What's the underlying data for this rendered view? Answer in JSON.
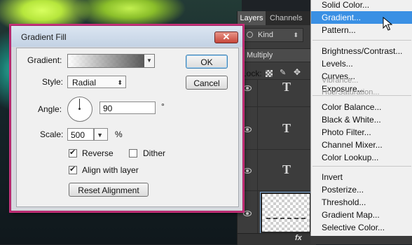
{
  "dialog": {
    "title": "Gradient Fill",
    "close_glyph": "✕",
    "gradient_label": "Gradient:",
    "style_label": "Style:",
    "style_value": "Radial",
    "angle_label": "Angle:",
    "angle_value": "90",
    "angle_unit": "°",
    "scale_label": "Scale:",
    "scale_value": "500",
    "scale_unit": "%",
    "reverse_label": "Reverse",
    "reverse_checked": true,
    "dither_label": "Dither",
    "dither_checked": false,
    "align_label": "Align with layer",
    "align_checked": true,
    "reset_label": "Reset Alignment",
    "ok_label": "OK",
    "cancel_label": "Cancel"
  },
  "layers_panel": {
    "tabs": [
      "Layers",
      "Channels"
    ],
    "kind_label": "Kind",
    "blend_mode": "Multiply",
    "lock_label": "Lock:",
    "text_layer_glyph": "T",
    "fx_label": "fx"
  },
  "menu": {
    "items": [
      {
        "label": "Solid Color...",
        "state": "normal"
      },
      {
        "label": "Gradient...",
        "state": "highlighted"
      },
      {
        "label": "Pattern...",
        "state": "normal"
      },
      {
        "label": "Brightness/Contrast...",
        "state": "normal"
      },
      {
        "label": "Levels...",
        "state": "normal"
      },
      {
        "label": "Curves...",
        "state": "normal"
      },
      {
        "label": "Exposure...",
        "state": "normal"
      },
      {
        "label": "Vibrance...",
        "state": "disabled"
      },
      {
        "label": "Hue/Saturation...",
        "state": "disabled"
      },
      {
        "label": "Color Balance...",
        "state": "normal"
      },
      {
        "label": "Black & White...",
        "state": "normal"
      },
      {
        "label": "Photo Filter...",
        "state": "normal"
      },
      {
        "label": "Channel Mixer...",
        "state": "normal"
      },
      {
        "label": "Color Lookup...",
        "state": "normal"
      },
      {
        "label": "Invert",
        "state": "normal"
      },
      {
        "label": "Posterize...",
        "state": "normal"
      },
      {
        "label": "Threshold...",
        "state": "normal"
      },
      {
        "label": "Gradient Map...",
        "state": "normal"
      },
      {
        "label": "Selective Color...",
        "state": "normal"
      }
    ]
  },
  "colors": {
    "menu_highlight": "#3a90e4",
    "dialog_border": "#c8307a",
    "panel_bg": "#3c3c3c"
  }
}
